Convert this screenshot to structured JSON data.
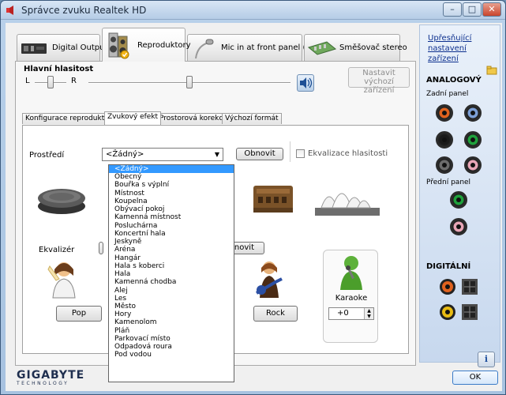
{
  "window": {
    "title": "Správce zvuku Realtek HD",
    "minimize_glyph": "–",
    "maximize_glyph": "□",
    "close_glyph": "✕"
  },
  "device_tabs": [
    {
      "label": "Digital Output",
      "icon": "digital-output-icon"
    },
    {
      "label": "Reproduktory",
      "icon": "speakers-icon",
      "active": true
    },
    {
      "label": "Mic in at front panel (Pink)",
      "icon": "microphone-icon"
    },
    {
      "label": "Směšovač stereo",
      "icon": "stereo-mixer-icon"
    }
  ],
  "volume": {
    "title": "Hlavní hlasitost",
    "left_label": "L",
    "right_label": "R",
    "balance": 0.5,
    "level": 0.5,
    "default_device_button": "Nastavit výchozí zařízení"
  },
  "sub_tabs": [
    {
      "label": "Konfigurace reproduktorů"
    },
    {
      "label": "Zvukový efekt",
      "active": true
    },
    {
      "label": "Prostorová korekce"
    },
    {
      "label": "Výchozí formát"
    }
  ],
  "effects": {
    "environment_label": "Prostředí",
    "environment_value": "<Žádný>",
    "reset_button": "Obnovit",
    "loudness_label": "Ekvalizace hlasitosti",
    "equalizer_label": "Ekvalizér",
    "eq_reset_button": "Obnovit",
    "pop_button": "Pop",
    "rock_button": "Rock",
    "karaoke_label": "Karaoke",
    "karaoke_value": "+0"
  },
  "environment_options": [
    "<Žádný>",
    "Obecný",
    "Bouřka s výplní",
    "Místnost",
    "Koupelna",
    "Obývací pokoj",
    "Kamenná místnost",
    "Posluchárna",
    "Koncertní hala",
    "Jeskyně",
    "Aréna",
    "Hangár",
    "Hala s koberci",
    "Hala",
    "Kamenná chodba",
    "Alej",
    "Les",
    "Město",
    "Hory",
    "Kamenolom",
    "Pláň",
    "Parkovací místo",
    "Odpadová roura",
    "Pod vodou"
  ],
  "side": {
    "link": "Upřesňující nastavení zařízení",
    "analog_heading": "ANALOGOVÝ",
    "rear_panel": "Zadní panel",
    "front_panel": "Přední panel",
    "digital_heading": "DIGITÁLNÍ"
  },
  "footer": {
    "brand": "GIGABYTE",
    "brand_sub": "TECHNOLOGY",
    "ok_button": "OK",
    "info_glyph": "i"
  },
  "colors": {
    "jack_orange": "#e0621e",
    "jack_blue": "#7c9fd6",
    "jack_black": "#1a1a1a",
    "jack_green": "#1fa13c",
    "jack_gray": "#6c6c6c",
    "jack_pink": "#e8a5b6",
    "selection": "#3399ff"
  }
}
